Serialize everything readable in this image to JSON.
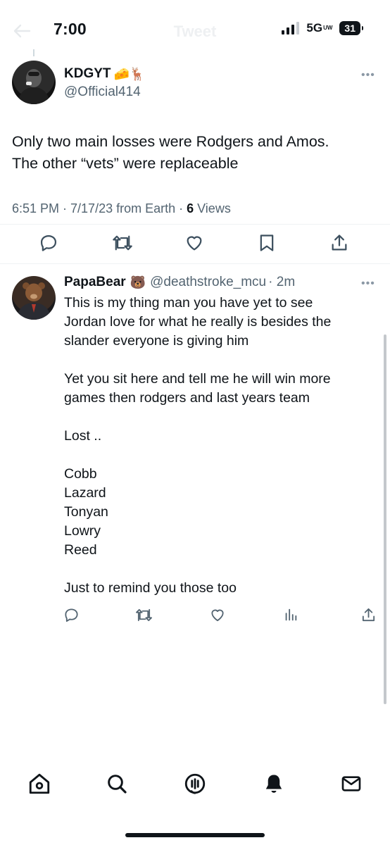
{
  "status_bar": {
    "time": "7:00",
    "network": "5G",
    "network_suffix": "UW",
    "battery": "31"
  },
  "header": {
    "title": "Tweet"
  },
  "tweet": {
    "display_name": "KDGYT",
    "name_emojis": "🧀🦌",
    "handle": "@Official414",
    "text_line1": "Only two main losses were Rodgers and Amos.",
    "text_line2": "The other “vets” were replaceable",
    "timestamp": "6:51 PM · 7/17/23 from Earth · ",
    "views_count": "6",
    "views_label": " Views"
  },
  "reply": {
    "display_name": "PapaBear",
    "name_emoji": "🐻",
    "handle": "@deathstroke_mcu",
    "time": "· 2m",
    "lines": [
      "This is my thing man you have yet to see",
      "Jordan love  for what he really is besides the",
      "slander everyone is giving him",
      "",
      "Yet you sit here and tell me he will win more",
      "games then rodgers and last years team",
      "",
      "Lost ..",
      "",
      "Cobb",
      "Lazard",
      "Tonyan",
      "Lowry",
      "Reed",
      "",
      "Just to remind you those too"
    ]
  },
  "icons": {
    "tweet_actions": [
      "reply-icon",
      "retweet-icon",
      "like-icon",
      "bookmark-icon",
      "share-icon"
    ],
    "reply_actions": [
      "reply-icon",
      "retweet-icon",
      "like-icon",
      "views-icon",
      "share-icon"
    ],
    "bottom_nav": [
      "home-icon",
      "search-icon",
      "spaces-icon",
      "notifications-icon",
      "messages-icon"
    ]
  },
  "colors": {
    "text": "#0f1419",
    "secondary": "#536471",
    "divider": "#eff3f4"
  }
}
